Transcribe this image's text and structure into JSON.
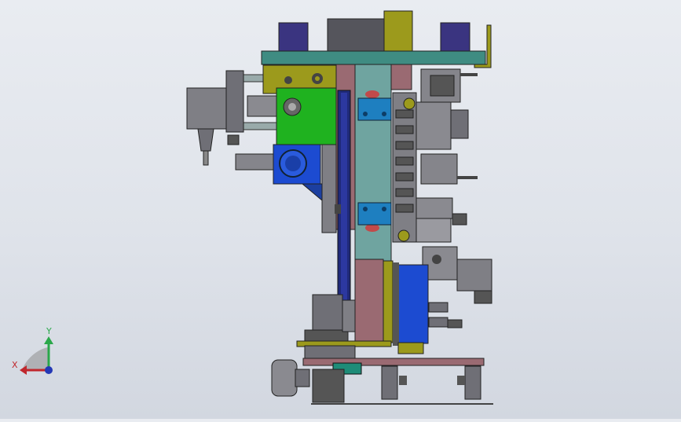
{
  "viewport": {
    "background_top": "#e9ecf1",
    "background_bottom": "#d2d7e0"
  },
  "triad": {
    "x_label": "X",
    "y_label": "Y",
    "x_color": "#c0272d",
    "y_color": "#2aa84a",
    "z_color": "#2438b5"
  },
  "model": {
    "colors": {
      "gray": "#7f7f85",
      "dark_gray": "#505058",
      "green": "#1fb21f",
      "blue": "#1c4bd1",
      "navy": "#202a7a",
      "purple": "#3a3480",
      "teal": "#3f8c82",
      "olive": "#9c9a1c",
      "pink": "#9a6a72",
      "light_teal": "#6fa4a0"
    }
  }
}
